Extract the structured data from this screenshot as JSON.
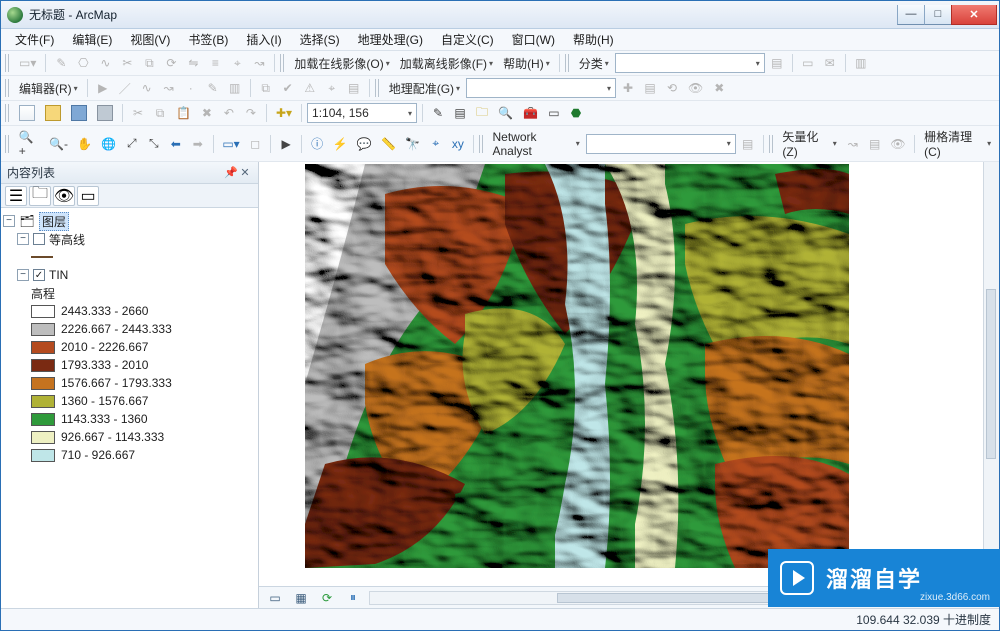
{
  "window": {
    "title": "无标题 - ArcMap"
  },
  "menu": [
    "文件(F)",
    "编辑(E)",
    "视图(V)",
    "书签(B)",
    "插入(I)",
    "选择(S)",
    "地理处理(G)",
    "自定义(C)",
    "窗口(W)",
    "帮助(H)"
  ],
  "toolbar_row1": {
    "load_online_imagery": "加载在线影像(O)",
    "load_contour_imagery": "加载离线影像(F)",
    "help": "帮助(H)",
    "classify": "分类"
  },
  "toolbar_row2": {
    "editor": "编辑器(R)",
    "georef": "地理配准(G)"
  },
  "toolbar_row3": {
    "scale": "1:104, 156"
  },
  "toolbar_row4": {
    "network_analyst": "Network Analyst",
    "vectorize": "矢量化(Z)",
    "grid_clean": "栅格清理(C)"
  },
  "toc": {
    "title": "内容列表",
    "root": "图层",
    "contour_layer": "等高线",
    "tin_layer": "TIN",
    "elevation_label": "高程",
    "classes": [
      {
        "label": "2443.333 - 2660",
        "color": "#ffffff"
      },
      {
        "label": "2226.667 - 2443.333",
        "color": "#bdbdbd"
      },
      {
        "label": "2010 - 2226.667",
        "color": "#b44b1f"
      },
      {
        "label": "1793.333 - 2010",
        "color": "#7a2a12"
      },
      {
        "label": "1576.667 - 1793.333",
        "color": "#c5731f"
      },
      {
        "label": "1360 - 1576.667",
        "color": "#b0b236"
      },
      {
        "label": "1143.333 - 1360",
        "color": "#2f9a3b"
      },
      {
        "label": "926.667 - 1143.333",
        "color": "#eef0c2"
      },
      {
        "label": "710 - 926.667",
        "color": "#bfe6e8"
      }
    ]
  },
  "status": {
    "coords": "109.644  32.039  十进制度"
  },
  "watermark": {
    "text": "溜溜自学",
    "sub": "zixue.3d66.com"
  },
  "chart_data": {
    "type": "map",
    "title": "TIN 高程",
    "field": "高程",
    "unit": "",
    "breaks": [
      710,
      926.667,
      1143.333,
      1360,
      1576.667,
      1793.333,
      2010,
      2226.667,
      2443.333,
      2660
    ],
    "classes": [
      {
        "range": [
          2443.333,
          2660
        ],
        "color": "#ffffff"
      },
      {
        "range": [
          2226.667,
          2443.333
        ],
        "color": "#bdbdbd"
      },
      {
        "range": [
          2010,
          2226.667
        ],
        "color": "#b44b1f"
      },
      {
        "range": [
          1793.333,
          2010
        ],
        "color": "#7a2a12"
      },
      {
        "range": [
          1576.667,
          1793.333
        ],
        "color": "#c5731f"
      },
      {
        "range": [
          1360,
          1576.667
        ],
        "color": "#b0b236"
      },
      {
        "range": [
          1143.333,
          1360
        ],
        "color": "#2f9a3b"
      },
      {
        "range": [
          926.667,
          1143.333
        ],
        "color": "#eef0c2"
      },
      {
        "range": [
          710,
          926.667
        ],
        "color": "#bfe6e8"
      }
    ],
    "center_lonlat": [
      109.644,
      32.039
    ],
    "scale_denominator": 104156
  }
}
